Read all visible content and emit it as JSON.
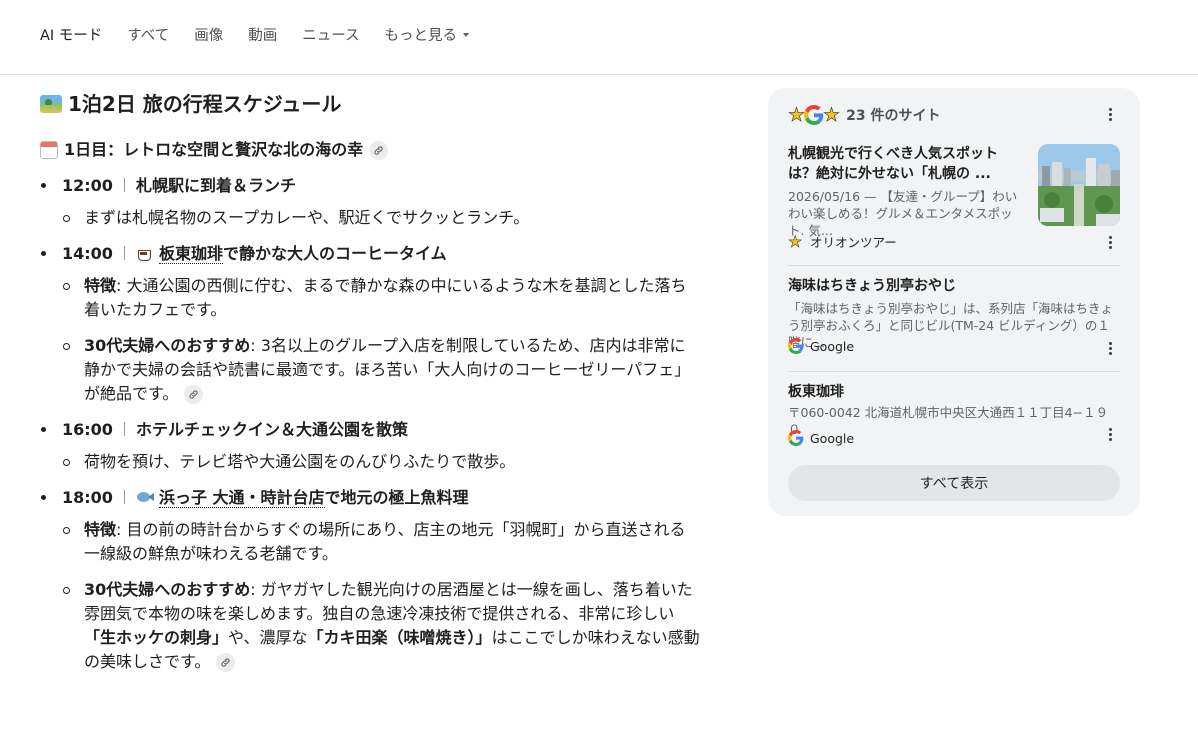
{
  "nav": {
    "tabs": [
      "AI モード",
      "すべて",
      "画像",
      "動画",
      "ニュース",
      "もっと見る"
    ]
  },
  "answer": {
    "title": "1泊2日 旅の行程スケジュール",
    "day1_heading": "1日目：レトロな空間と贅沢な北の海の幸",
    "items": [
      {
        "time": "12:00",
        "title": "札幌駅に到着＆ランチ",
        "subs": [
          {
            "text": "まずは札幌名物のスープカレーや、駅近くでサクッとランチ。"
          }
        ]
      },
      {
        "time": "14:00",
        "place": "板東珈琲",
        "title_rest": "で静かな大人のコーヒータイム",
        "subs": [
          {
            "label": "特徴",
            "text": ": 大通公園の西側に佇む、まるで静かな森の中にいるような木を基調とした落ち着いたカフェです。"
          },
          {
            "label": "30代夫婦へのおすすめ",
            "text": ": 3名以上のグループ入店を制限しているため、店内は非常に静かで夫婦の会話や読書に最適です。ほろ苦い「大人向けのコーヒーゼリーパフェ」が絶品です。"
          }
        ]
      },
      {
        "time": "16:00",
        "title": "ホテルチェックイン＆大通公園を散策",
        "subs": [
          {
            "text": "荷物を預け、テレビ塔や大通公園をのんびりふたりで散歩。"
          }
        ]
      },
      {
        "time": "18:00",
        "place": "浜っ子 大通・時計台店",
        "title_rest": "で地元の極上魚料理",
        "subs": [
          {
            "label": "特徴",
            "text": ": 目の前の時計台からすぐの場所にあり、店主の地元「羽幌町」から直送される一線級の鮮魚が味わえる老舗です。"
          },
          {
            "label": "30代夫婦へのおすすめ",
            "text_a": ": ガヤガヤした観光向けの居酒屋とは一線を画し、落ち着いた雰囲気で本物の味を楽しめます。独自の急速冷凍技術で提供される、非常に珍しい",
            "bold_a": "「生ホッケの刺身」",
            "text_b": "や、濃厚な",
            "bold_b": "「カキ田楽（味噌焼き）」",
            "text_c": "はここでしか味わえない感動の美味しさです。"
          }
        ]
      }
    ]
  },
  "panel": {
    "count_label": "23 件のサイト",
    "sources": [
      {
        "title": "札幌観光で行くべき人気スポットは？絶対に外せない「札幌の ...",
        "snippet": "2026/05/16 — 【友達・グループ】わいわい楽しめる！グルメ＆エンタメスポット. 気...",
        "site": "オリオンツアー",
        "favicon": "star-icon"
      },
      {
        "title": "海味はちきょう別亭おやじ",
        "snippet": "「海味はちきょう別亭おやじ」は、系列店「海味はちきょう別亭おふくろ」と同じビル(TM-24 ビルディング）の１階に...",
        "site": "Google",
        "favicon": "google-icon"
      },
      {
        "title": "板東珈琲",
        "snippet": "〒060-0042 北海道札幌市中央区大通西１１丁目4−１９０",
        "site": "Google",
        "favicon": "google-icon"
      }
    ],
    "show_all": "すべて表示"
  }
}
